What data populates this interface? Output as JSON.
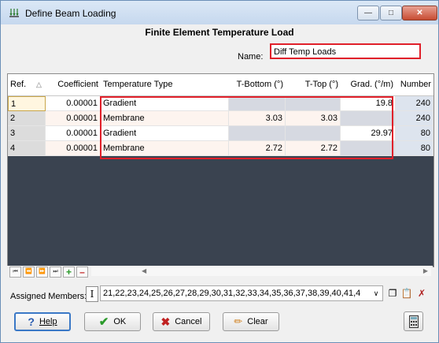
{
  "window": {
    "title": "Define Beam Loading"
  },
  "form": {
    "heading": "Finite Element Temperature Load",
    "name_label": "Name:",
    "name_value": "Diff Temp Loads"
  },
  "columns": [
    "Ref.",
    "Coefficient",
    "Temperature Type",
    "T-Bottom (°)",
    "T-Top (°)",
    "Grad. (°/m)",
    "Number"
  ],
  "rows": [
    {
      "ref": "1",
      "coefficient": "0.00001",
      "type": "Gradient",
      "t_bottom": "",
      "t_top": "",
      "grad": "19.8",
      "number": "240"
    },
    {
      "ref": "2",
      "coefficient": "0.00001",
      "type": "Membrane",
      "t_bottom": "3.03",
      "t_top": "3.03",
      "grad": "",
      "number": "240"
    },
    {
      "ref": "3",
      "coefficient": "0.00001",
      "type": "Gradient",
      "t_bottom": "",
      "t_top": "",
      "grad": "29.97",
      "number": "80"
    },
    {
      "ref": "4",
      "coefficient": "0.00001",
      "type": "Membrane",
      "t_bottom": "2.72",
      "t_top": "2.72",
      "grad": "",
      "number": "80"
    }
  ],
  "assigned": {
    "label": "Assigned Members:",
    "value": "21,22,23,24,25,26,27,28,29,30,31,32,33,34,35,36,37,38,39,40,41,4"
  },
  "buttons": {
    "help": "Help",
    "ok": "OK",
    "cancel": "Cancel",
    "clear": "Clear"
  },
  "colors": {
    "highlight": "#e0202a",
    "grid_bg": "#3a4350"
  }
}
